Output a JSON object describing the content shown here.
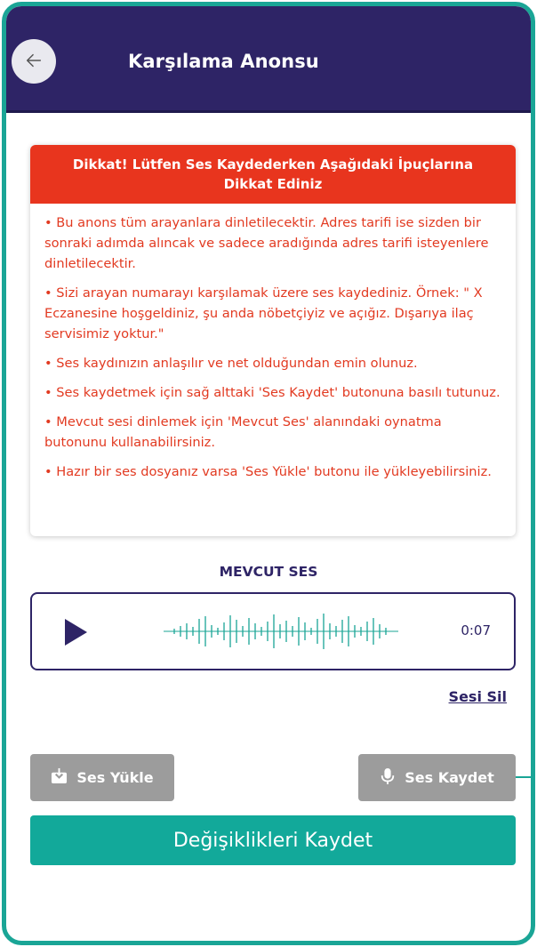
{
  "header": {
    "title": "Karşılama Anonsu",
    "back_icon": "arrow-left-icon",
    "bg_color": "#2e2466"
  },
  "tips": {
    "heading": "Dikkat! Lütfen Ses Kaydederken Aşağıdaki İpuçlarına Dikkat Ediniz",
    "heading_color": "#e8351e",
    "items": [
      "• Bu anons tüm arayanlara dinletilecektir. Adres tarifi ise sizden bir sonraki adımda alıncak ve sadece aradığında adres tarifi isteyenlere dinletilecektir.",
      "• Sizi arayan numarayı karşılamak üzere ses kaydediniz. Örnek: \" X Eczanesine hoşgeldiniz, şu anda nöbetçiyiz ve açığız. Dışarıya ilaç servisimiz yoktur.\"",
      "• Ses kaydınızın anlaşılır ve net olduğundan emin olunuz.",
      "• Ses kaydetmek için sağ alttaki 'Ses Kaydet' butonuna basılı tutunuz.",
      "• Mevcut sesi dinlemek için 'Mevcut Ses' alanındaki oynatma butonunu kullanabilirsiniz.",
      "• Hazır bir ses dosyanız varsa 'Ses Yükle' butonu ile yükleyebilirsiniz."
    ]
  },
  "current_audio": {
    "section_title": "MEVCUT SES",
    "duration": "0:07",
    "play_icon": "play-icon",
    "waveform_icon": "waveform-icon",
    "delete_label": "Sesi Sil"
  },
  "actions": {
    "upload_label": "Ses Yükle",
    "upload_icon": "download-tray-icon",
    "record_label": "Ses Kaydet",
    "record_icon": "microphone-icon",
    "save_label": "Değişiklikleri Kaydet",
    "save_color": "#12a99a"
  }
}
